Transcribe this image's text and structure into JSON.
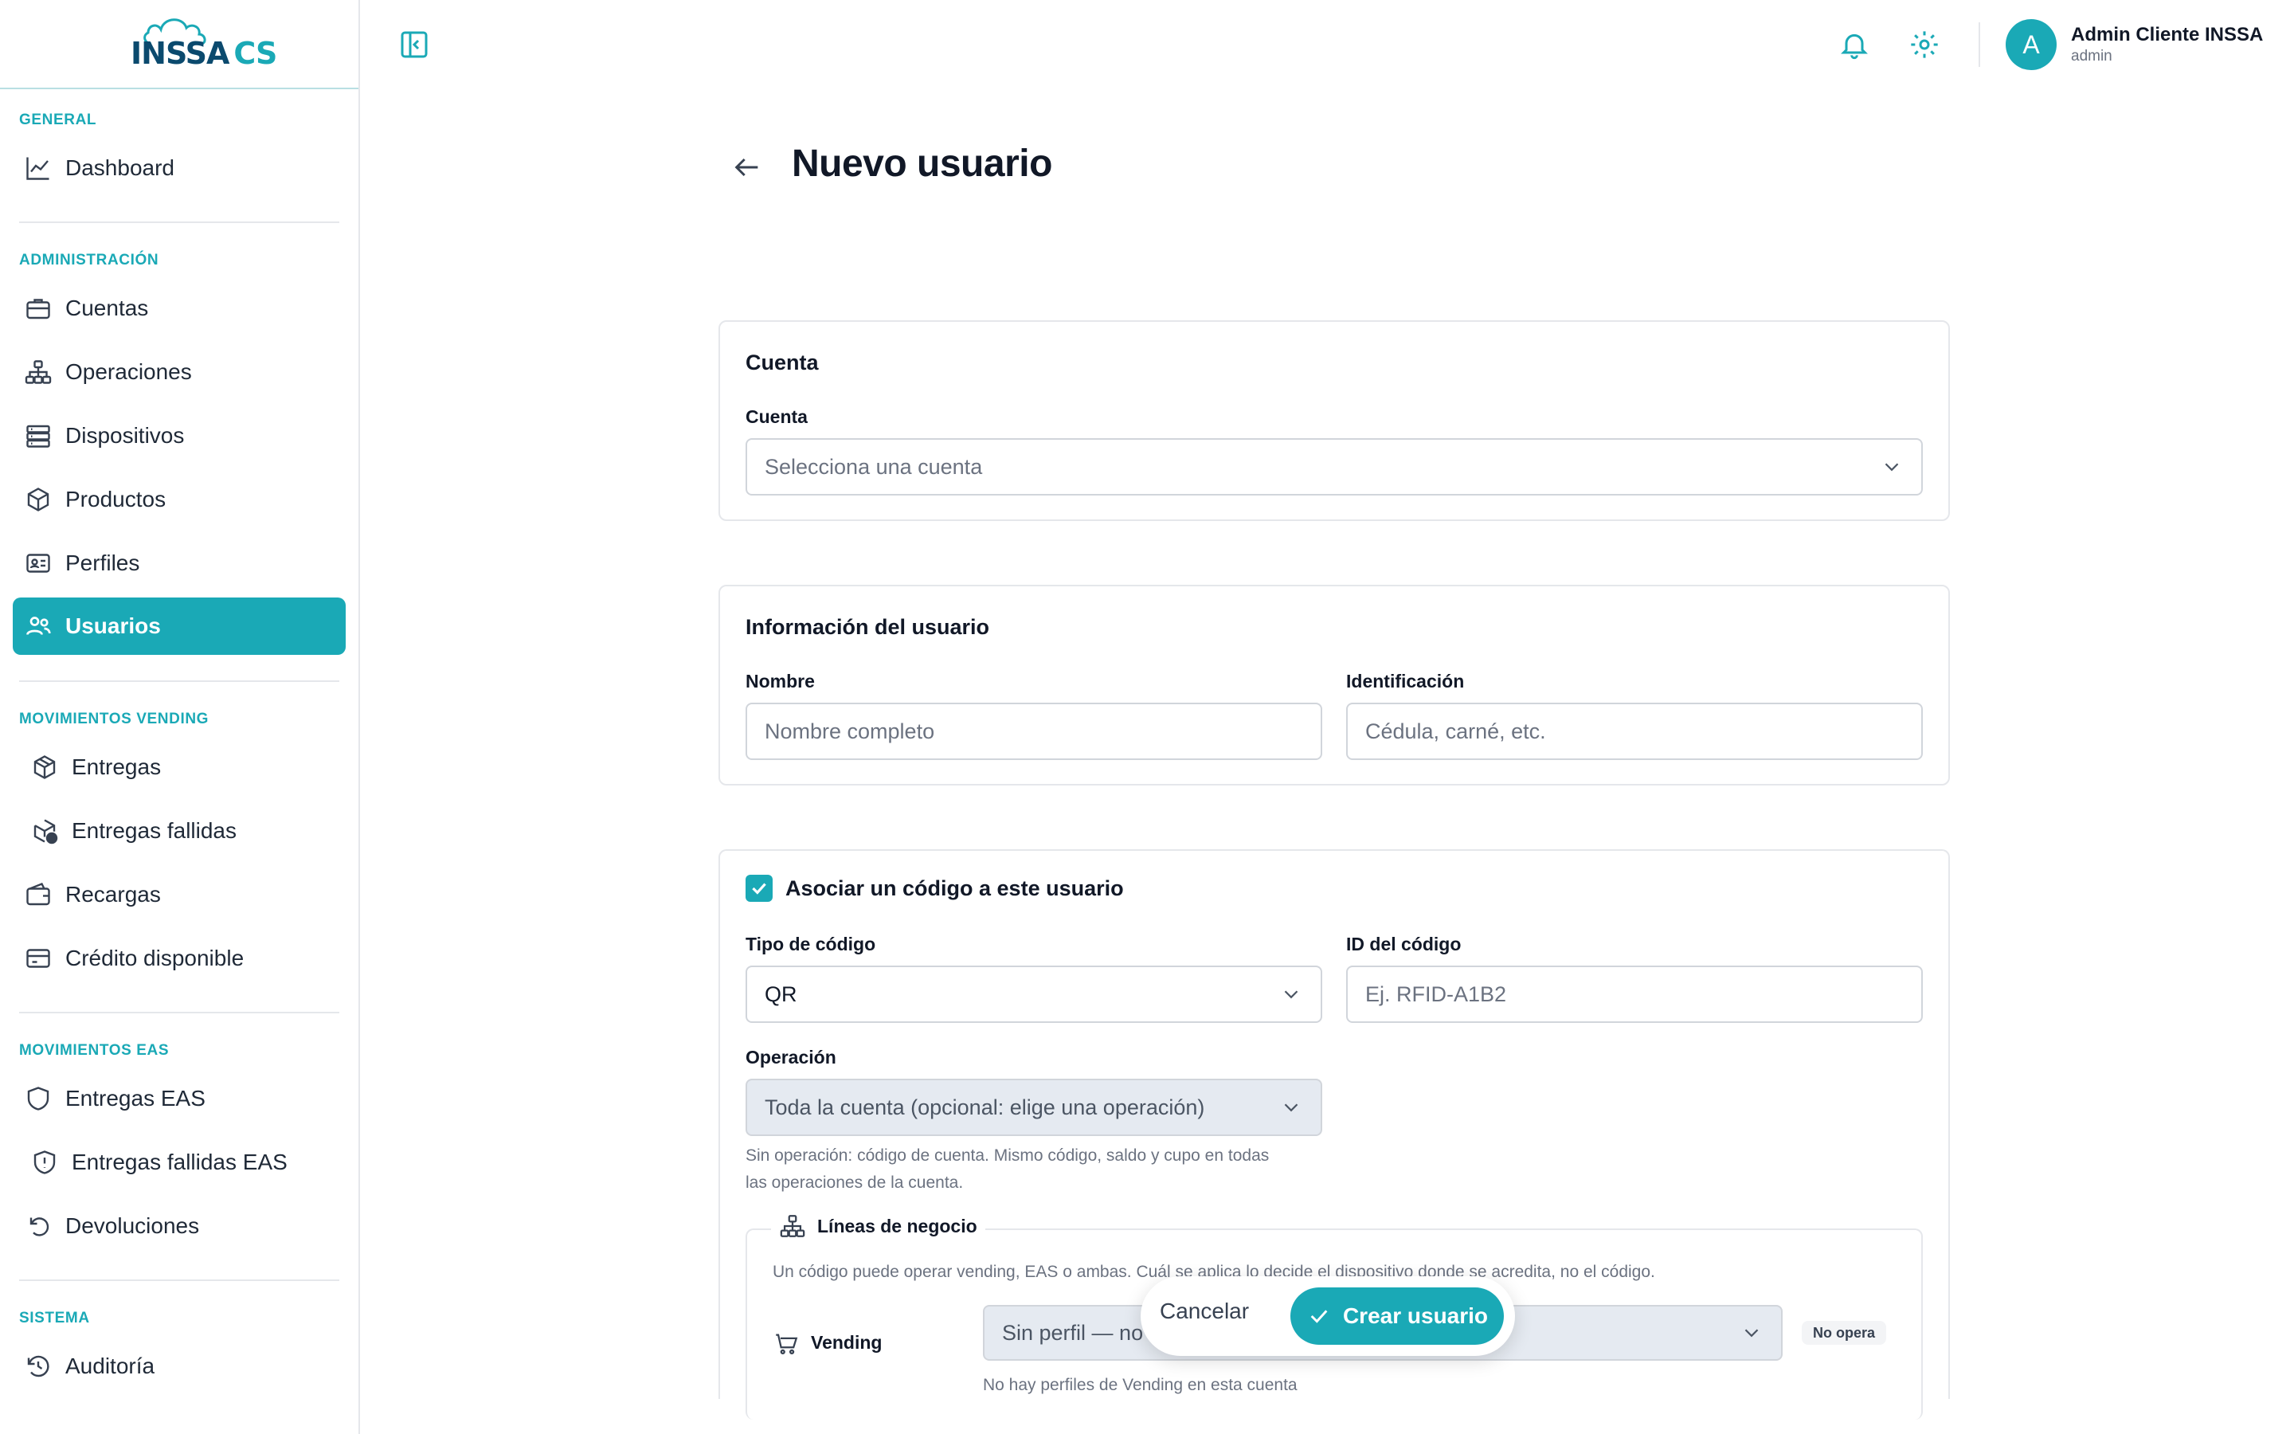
{
  "brand": {
    "logo_text": "INSSA CS"
  },
  "sidebar": {
    "sections": [
      {
        "label": "GENERAL",
        "items": [
          {
            "label": "Dashboard",
            "icon": "chart-line-icon"
          }
        ]
      },
      {
        "label": "ADMINISTRACIÓN",
        "items": [
          {
            "label": "Cuentas",
            "icon": "briefcase-icon"
          },
          {
            "label": "Operaciones",
            "icon": "hierarchy-icon"
          },
          {
            "label": "Dispositivos",
            "icon": "server-icon"
          },
          {
            "label": "Productos",
            "icon": "box-icon"
          },
          {
            "label": "Perfiles",
            "icon": "id-card-icon"
          },
          {
            "label": "Usuarios",
            "icon": "users-icon",
            "active": true
          }
        ]
      },
      {
        "label": "MOVIMIENTOS VENDING",
        "items": [
          {
            "label": "Entregas",
            "icon": "package-icon"
          },
          {
            "label": "Entregas fallidas",
            "icon": "package-alert-icon"
          },
          {
            "label": "Recargas",
            "icon": "wallet-icon"
          },
          {
            "label": "Crédito disponible",
            "icon": "credit-card-icon"
          }
        ]
      },
      {
        "label": "MOVIMIENTOS EAS",
        "items": [
          {
            "label": "Entregas EAS",
            "icon": "shield-icon"
          },
          {
            "label": "Entregas fallidas EAS",
            "icon": "shield-alert-icon"
          },
          {
            "label": "Devoluciones",
            "icon": "undo-icon"
          }
        ]
      },
      {
        "label": "SISTEMA",
        "items": [
          {
            "label": "Auditoría",
            "icon": "history-icon"
          }
        ]
      }
    ]
  },
  "topbar": {
    "user_initial": "A",
    "user_name": "Admin Cliente INSSA",
    "user_role": "admin",
    "icons": [
      "sidebar-toggle-icon",
      "bell-icon",
      "gear-icon"
    ]
  },
  "page": {
    "title": "Nuevo usuario"
  },
  "account_card": {
    "title": "Cuenta",
    "field_label": "Cuenta",
    "placeholder": "Selecciona una cuenta"
  },
  "user_card": {
    "title": "Información del usuario",
    "name_label": "Nombre",
    "name_placeholder": "Nombre completo",
    "id_label": "Identificación",
    "id_placeholder": "Cédula, carné, etc."
  },
  "code_card": {
    "checkbox_label": "Asociar un código a este usuario",
    "checked": true,
    "type_label": "Tipo de código",
    "type_value": "QR",
    "id_label": "ID del código",
    "id_placeholder": "Ej. RFID-A1B2",
    "operation_label": "Operación",
    "operation_value": "Toda la cuenta (opcional: elige una operación)",
    "operation_help_1": "Sin operación: código de cuenta. Mismo código, saldo y cupo en todas",
    "operation_help_2": "las operaciones de la cuenta.",
    "business_lines": {
      "legend": "Líneas de negocio",
      "description": "Un código puede operar vending, EAS o ambas. Cuál se aplica lo decide el dispositivo donde se acredita, no el código.",
      "vending_label": "Vending",
      "vending_value": "Sin perfil — no",
      "vending_badge": "No opera",
      "vending_help": "No hay perfiles de Vending en esta cuenta"
    }
  },
  "actions": {
    "cancel": "Cancelar",
    "create": "Crear usuario"
  },
  "colors": {
    "accent": "#1aa9b6",
    "text": "#111827",
    "muted": "#6b7280",
    "border": "#e5e7eb"
  }
}
